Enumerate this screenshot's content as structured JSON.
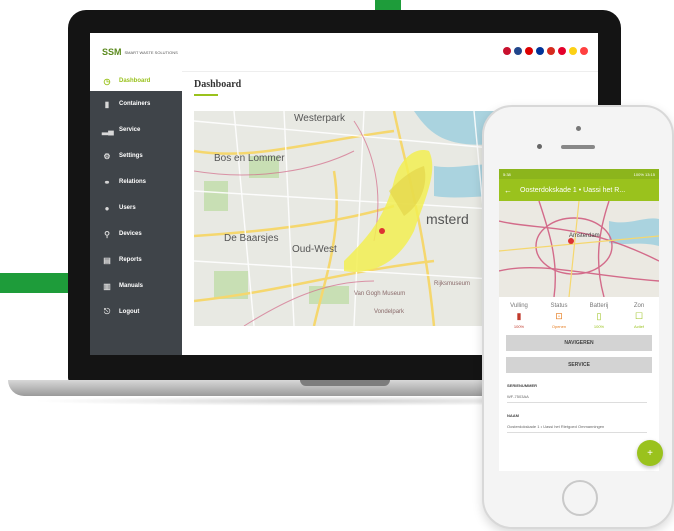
{
  "brand": {
    "logo_text": "SSM",
    "logo_sub": "SMART WASTE SOLUTIONS"
  },
  "colors": {
    "accent": "#9ac21d",
    "brand_green": "#1e9c3a",
    "sidebar": "#3f4449"
  },
  "sidebar": {
    "items": [
      {
        "label": "Dashboard",
        "icon": "dashboard-icon"
      },
      {
        "label": "Containers",
        "icon": "container-icon"
      },
      {
        "label": "Service",
        "icon": "chart-icon"
      },
      {
        "label": "Settings",
        "icon": "gear-icon"
      },
      {
        "label": "Relations",
        "icon": "relations-icon"
      },
      {
        "label": "Users",
        "icon": "user-icon"
      },
      {
        "label": "Devices",
        "icon": "device-icon"
      },
      {
        "label": "Reports",
        "icon": "report-icon"
      },
      {
        "label": "Manuals",
        "icon": "book-icon"
      },
      {
        "label": "Logout",
        "icon": "logout-icon"
      }
    ]
  },
  "header": {
    "title": "Dashboard",
    "flags": [
      "#c8102e",
      "#21468b",
      "#dd0000",
      "#003399",
      "#d52b1e",
      "#e4002b",
      "#fcd116",
      "#ff4040"
    ]
  },
  "map": {
    "labels": [
      "Westerpark",
      "Bos en Lommer",
      "De Baarsjes",
      "Oud-West",
      "msterd"
    ],
    "small_labels": [
      "Van Gogh Museum",
      "Rijksmuseum",
      "Vondelpark"
    ]
  },
  "phone": {
    "status_left": "5:38",
    "status_right": "100% 13:15",
    "appbar_title": "Oosterdokskade 1 • Uassi het R...",
    "map_label": "Amsterdam",
    "status": [
      {
        "title": "Vulling",
        "value": "100%",
        "icon": "bin-icon",
        "color": "#c0392b"
      },
      {
        "title": "Status",
        "value": "Openen",
        "icon": "lock-icon",
        "color": "#e67e22"
      },
      {
        "title": "Batterij",
        "value": "100%",
        "icon": "battery-icon",
        "color": "#9ac21d"
      },
      {
        "title": "Zon",
        "value": "Actief",
        "icon": "sun-icon",
        "color": "#9ac21d"
      }
    ],
    "buttons": [
      "NAVIGEREN",
      "SERVICE"
    ],
    "fields": [
      {
        "label": "SERIENUMMER",
        "value": "WF-7503AA"
      },
      {
        "label": "NAAM",
        "value": "Oosterdokskade 1 • Uassi het Rietgoed Ommanningen"
      }
    ],
    "fab_icon": "+"
  }
}
